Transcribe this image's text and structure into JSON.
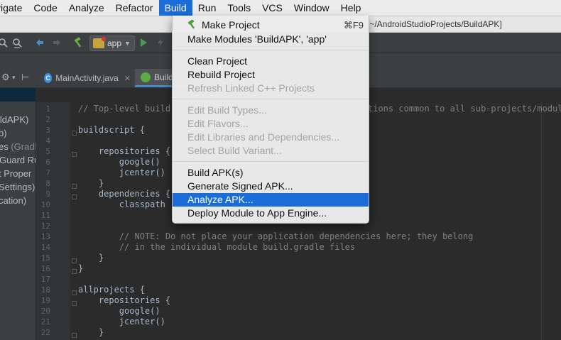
{
  "menubar": {
    "items": [
      "vigate",
      "Code",
      "Analyze",
      "Refactor",
      "Build",
      "Run",
      "Tools",
      "VCS",
      "Window",
      "Help"
    ],
    "active": "Build"
  },
  "titlebar": {
    "path": "[~/AndroidStudioProjects/BuildAPK]"
  },
  "toolbar": {
    "run_config": "app"
  },
  "tabs": [
    {
      "label": "MainActivity.java"
    },
    {
      "label": "Build"
    }
  ],
  "project_panel": {
    "items": [
      {
        "text": "ildAPK)"
      },
      {
        "text": "p)"
      },
      {
        "text": "es",
        "suffix": " (Gradl"
      },
      {
        "text": "Guard Ru"
      },
      {
        "text": "t Proper"
      },
      {
        "text": "Settings)"
      },
      {
        "text": "cation)"
      }
    ]
  },
  "editor": {
    "line_numbers": [
      "1",
      "2",
      "3",
      "4",
      "5",
      "6",
      "7",
      "8",
      "9",
      "10",
      "11",
      "12",
      "13",
      "14",
      "15",
      "16",
      "17",
      "18",
      "19",
      "20",
      "21",
      "22"
    ],
    "lines": [
      {
        "text": "// Top-level build",
        "kind": "cm"
      },
      {
        "text": "tions common to all sub-projects/module",
        "kind": "cm",
        "right": true
      },
      {
        "text": "buildscript {",
        "kind": "fn"
      },
      {
        "text": "    repositories {",
        "kind": "fn"
      },
      {
        "text": "        google()",
        "kind": "fn"
      },
      {
        "text": "        jcenter()",
        "kind": "fn"
      },
      {
        "text": "    }",
        "kind": "fn"
      },
      {
        "text": "    dependencies {",
        "kind": "fn"
      },
      {
        "text": "        classpath '",
        "kind": "fn"
      },
      {
        "text": "        // NOTE: Do not place your application dependencies here; they belong",
        "kind": "cm"
      },
      {
        "text": "        // in the individual module build.gradle files",
        "kind": "cm"
      },
      {
        "text": "    }",
        "kind": "fn"
      },
      {
        "text": "}",
        "kind": "fn"
      },
      {
        "text": "allprojects {",
        "kind": "fn"
      },
      {
        "text": "    repositories {",
        "kind": "fn"
      },
      {
        "text": "        google()",
        "kind": "fn"
      },
      {
        "text": "        jcenter()",
        "kind": "fn"
      },
      {
        "text": "    }",
        "kind": "fn"
      }
    ]
  },
  "build_menu": {
    "make_project": "Make Project",
    "make_project_shortcut": "⌘F9",
    "make_modules": "Make Modules 'BuildAPK', 'app'",
    "clean_project": "Clean Project",
    "rebuild_project": "Rebuild Project",
    "refresh_cpp": "Refresh Linked C++ Projects",
    "edit_build_types": "Edit Build Types...",
    "edit_flavors": "Edit Flavors...",
    "edit_libraries": "Edit Libraries and Dependencies...",
    "select_variant": "Select Build Variant...",
    "build_apk": "Build APK(s)",
    "generate_signed": "Generate Signed APK...",
    "analyze_apk": "Analyze APK...",
    "deploy_module": "Deploy Module to App Engine..."
  }
}
